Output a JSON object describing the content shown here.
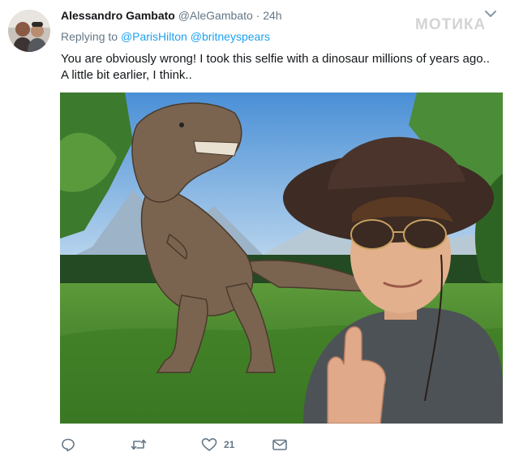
{
  "author": {
    "name": "Alessandro Gambato",
    "handle": "@AleGambato",
    "separator": "·",
    "time": "24h",
    "avatar_icon": "avatar-photo"
  },
  "watermark": "МОТИКА",
  "reply": {
    "prefix": "Replying to",
    "mentions": [
      "@ParisHilton",
      "@britneyspears"
    ]
  },
  "tweet_text": {
    "line1": "You are obviously wrong! I took this selfie with a dinosaur millions of years ago..",
    "line2": "A little bit earlier, I think.."
  },
  "media": {
    "description_icon": "selfie-with-t-rex-photo"
  },
  "actions": {
    "reply_icon": "reply-icon",
    "retweet_icon": "retweet-icon",
    "like_icon": "heart-icon",
    "like_count": "21",
    "dm_icon": "envelope-icon"
  },
  "colors": {
    "link": "#1da1f2",
    "secondary_text": "#657786",
    "primary_text": "#14171a"
  }
}
